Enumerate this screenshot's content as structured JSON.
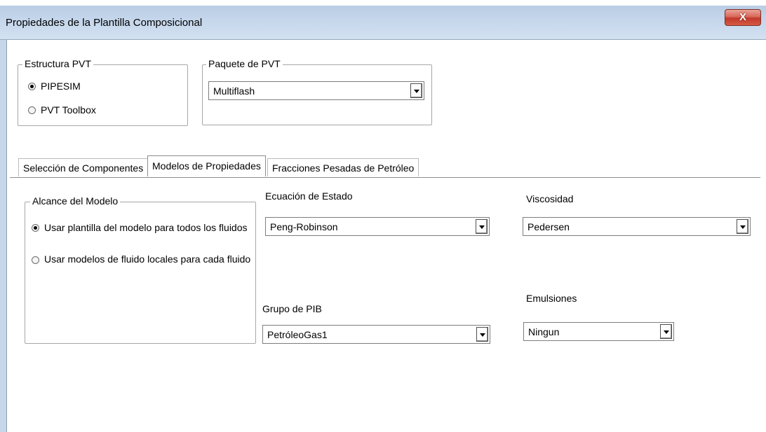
{
  "window": {
    "title": "Propiedades de la Plantilla Composicional",
    "close_label": "X"
  },
  "estructura_pvt": {
    "legend": "Estructura PVT",
    "options": [
      {
        "label": "PIPESIM",
        "checked": true
      },
      {
        "label": "PVT Toolbox",
        "checked": false
      }
    ]
  },
  "paquete_pvt": {
    "legend": "Paquete de PVT",
    "selected": "Multiflash"
  },
  "tabs": [
    {
      "label": "Selección de Componentes",
      "active": false
    },
    {
      "label": "Modelos de Propiedades",
      "active": true
    },
    {
      "label": "Fracciones Pesadas de Petróleo",
      "active": false
    }
  ],
  "alcance": {
    "legend": "Alcance del Modelo",
    "options": [
      {
        "label": "Usar plantilla del modelo para todos los fluidos",
        "checked": true
      },
      {
        "label": "Usar modelos de fluido locales para cada fluido",
        "checked": false
      }
    ]
  },
  "ecuacion": {
    "label": "Ecuación de Estado",
    "selected": "Peng-Robinson"
  },
  "viscosidad": {
    "label": "Viscosidad",
    "selected": "Pedersen"
  },
  "grupo_pib": {
    "label": "Grupo de PIB",
    "selected": "PetróleoGas1"
  },
  "emulsiones": {
    "label": "Emulsiones",
    "selected": "Ningun"
  }
}
